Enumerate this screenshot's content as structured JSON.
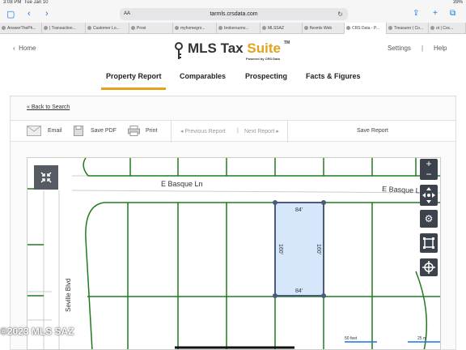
{
  "statusbar": {
    "time": "3:08 PM",
    "date": "Tue Jan 10",
    "battery": "39%"
  },
  "browser": {
    "url": "tarmls.crsdata.com",
    "aa": "AA"
  },
  "tabs": [
    "AnswerThePh...",
    "| Transaction...",
    "Customer Lo...",
    "Provi",
    "myhomegro...",
    "brokersumo...",
    "MLSSAZ",
    "flexmls Web",
    "CRS Data - P...",
    "Treasurer | Co...",
    "ot | Coc..."
  ],
  "header": {
    "home": "Home",
    "logo_main": "MLS Tax ",
    "logo_accent": "Suite",
    "logo_tm": "TM",
    "logo_sub": "Powered by CRS Data",
    "settings": "Settings",
    "separator": "|",
    "help": "Help"
  },
  "nav": [
    "Property Report",
    "Comparables",
    "Prospecting",
    "Facts & Figures"
  ],
  "back": "« Back to Search",
  "toolbar": {
    "email": "Email",
    "save_pdf": "Save PDF",
    "print": "Print",
    "prev": "Previous Report",
    "divider": "|",
    "next": "Next Report",
    "save_report": "Save Report"
  },
  "map": {
    "street_left": "E Basque Ln",
    "street_right": "E Basque Ln",
    "blvd": "Seville Blvd",
    "lot_top": "84'",
    "lot_bottom": "84'",
    "lot_left": "160'",
    "lot_right": "160'",
    "scale_feet": "50 feet",
    "scale_m": "25 m"
  },
  "watermark": "©2023 MLS SAZ",
  "colors": {
    "accent": "#e2a21b",
    "lot_fill": "#d6e6fb",
    "lot_border": "#4a5a7a",
    "parcel_line": "#1f7a1f"
  }
}
